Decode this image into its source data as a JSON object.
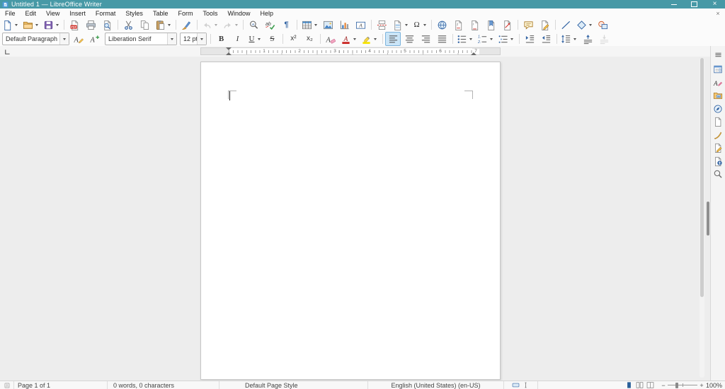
{
  "window": {
    "title": "Untitled 1 — LibreOffice Writer",
    "close_glyph": "×"
  },
  "menubar": {
    "items": [
      "File",
      "Edit",
      "View",
      "Insert",
      "Format",
      "Styles",
      "Table",
      "Form",
      "Tools",
      "Window",
      "Help"
    ],
    "close_glyph": "×"
  },
  "standard_toolbar": {
    "buttons": [
      "new-document",
      "open",
      "save",
      "export-pdf",
      "print",
      "print-preview",
      "cut",
      "copy",
      "paste",
      "clone-formatting",
      "undo",
      "redo",
      "find-and-replace",
      "spelling",
      "formatting-marks",
      "insert-table",
      "insert-image",
      "insert-chart",
      "insert-text-box",
      "insert-page-break",
      "insert-field",
      "insert-special-character",
      "insert-hyperlink",
      "insert-footnote",
      "insert-endnote",
      "insert-bookmark",
      "insert-cross-reference",
      "insert-comment",
      "track-changes",
      "insert-line",
      "basic-shapes",
      "show-draw-functions"
    ]
  },
  "formatting_toolbar": {
    "paragraph_style": "Default Paragraph Style",
    "font_name": "Liberation Serif",
    "font_size": "12 pt",
    "bold": "B",
    "italic": "I",
    "underline": "U",
    "strikethrough": "S",
    "superscript": "x²",
    "subscript": "x₂"
  },
  "glyphs": {
    "pilcrow": "¶",
    "omega": "Ω"
  },
  "ruler": {
    "numbers": [
      "1",
      "2",
      "3",
      "4",
      "5",
      "6",
      "7"
    ]
  },
  "sidebar": {
    "items": [
      "sidebar-settings",
      "properties",
      "styles",
      "gallery",
      "navigator",
      "page",
      "style-inspector",
      "manage-changes",
      "accessibility-check",
      "find"
    ]
  },
  "statusbar": {
    "page_number": "Page 1 of 1",
    "word_count": "0 words, 0 characters",
    "page_style": "Default Page Style",
    "language": "English (United States) (en-US)",
    "zoom_out": "−",
    "zoom_in": "+",
    "zoom_level": "100%"
  },
  "colors": {
    "titlebar": "#4799a6",
    "accent": "#3465a4",
    "active_toggle_bg": "#cbe5f7"
  }
}
